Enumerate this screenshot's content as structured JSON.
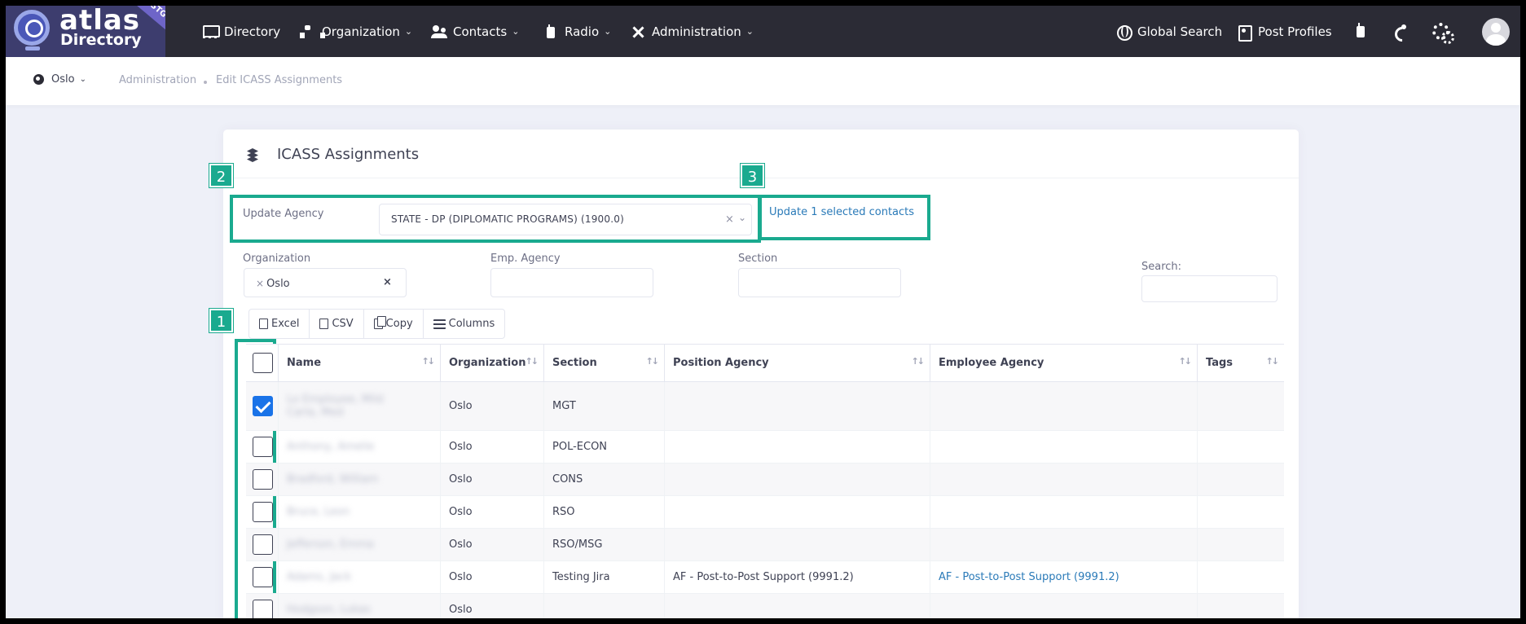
{
  "app": {
    "logo_title": "atlas",
    "logo_subtitle": "Directory",
    "logo_badge": "STG"
  },
  "nav": {
    "directory": "Directory",
    "organization": "Organization",
    "contacts": "Contacts",
    "radio": "Radio",
    "administration": "Administration",
    "global_search": "Global Search",
    "post_profiles": "Post Profiles"
  },
  "subheader": {
    "post": "Oslo",
    "breadcrumb": [
      "Administration",
      "Edit ICASS Assignments"
    ]
  },
  "card": {
    "title": "ICASS Assignments"
  },
  "markers": [
    "1",
    "2",
    "3"
  ],
  "update": {
    "label": "Update Agency",
    "selected_value": "STATE - DP (DIPLOMATIC PROGRAMS) (1900.0)",
    "clear_symbol": "×",
    "action_link": "Update 1 selected contacts"
  },
  "filters": {
    "organization_label": "Organization",
    "organization_chip": "Oslo",
    "emp_agency_label": "Emp. Agency",
    "section_label": "Section",
    "search_label": "Search:",
    "search_value": ""
  },
  "export_buttons": [
    "Excel",
    "CSV",
    "Copy",
    "Columns"
  ],
  "table": {
    "headers": [
      "Name",
      "Organization",
      "Section",
      "Position Agency",
      "Employee Agency",
      "Tags"
    ],
    "rows": [
      {
        "name": "Lo Employee, Mild Carla, Med",
        "organization": "Oslo",
        "section": "MGT",
        "position_agency": "",
        "employee_agency": "",
        "tags": "",
        "checked": true
      },
      {
        "name": "Anthony, Amelie",
        "organization": "Oslo",
        "section": "POL-ECON",
        "position_agency": "",
        "employee_agency": "",
        "tags": "",
        "checked": false
      },
      {
        "name": "Bradford, William",
        "organization": "Oslo",
        "section": "CONS",
        "position_agency": "",
        "employee_agency": "",
        "tags": "",
        "checked": false
      },
      {
        "name": "Bruce, Leon",
        "organization": "Oslo",
        "section": "RSO",
        "position_agency": "",
        "employee_agency": "",
        "tags": "",
        "checked": false
      },
      {
        "name": "Jefferson, Emma",
        "organization": "Oslo",
        "section": "RSO/MSG",
        "position_agency": "",
        "employee_agency": "",
        "tags": "",
        "checked": false
      },
      {
        "name": "Adams, Jack",
        "organization": "Oslo",
        "section": "Testing Jira",
        "position_agency": "AF - Post-to-Post Support (9991.2)",
        "employee_agency": "AF - Post-to-Post Support (9991.2)",
        "tags": "",
        "checked": false
      },
      {
        "name": "Hodgson, Lukas",
        "organization": "Oslo",
        "section": "",
        "position_agency": "",
        "employee_agency": "",
        "tags": "",
        "checked": false
      }
    ]
  }
}
